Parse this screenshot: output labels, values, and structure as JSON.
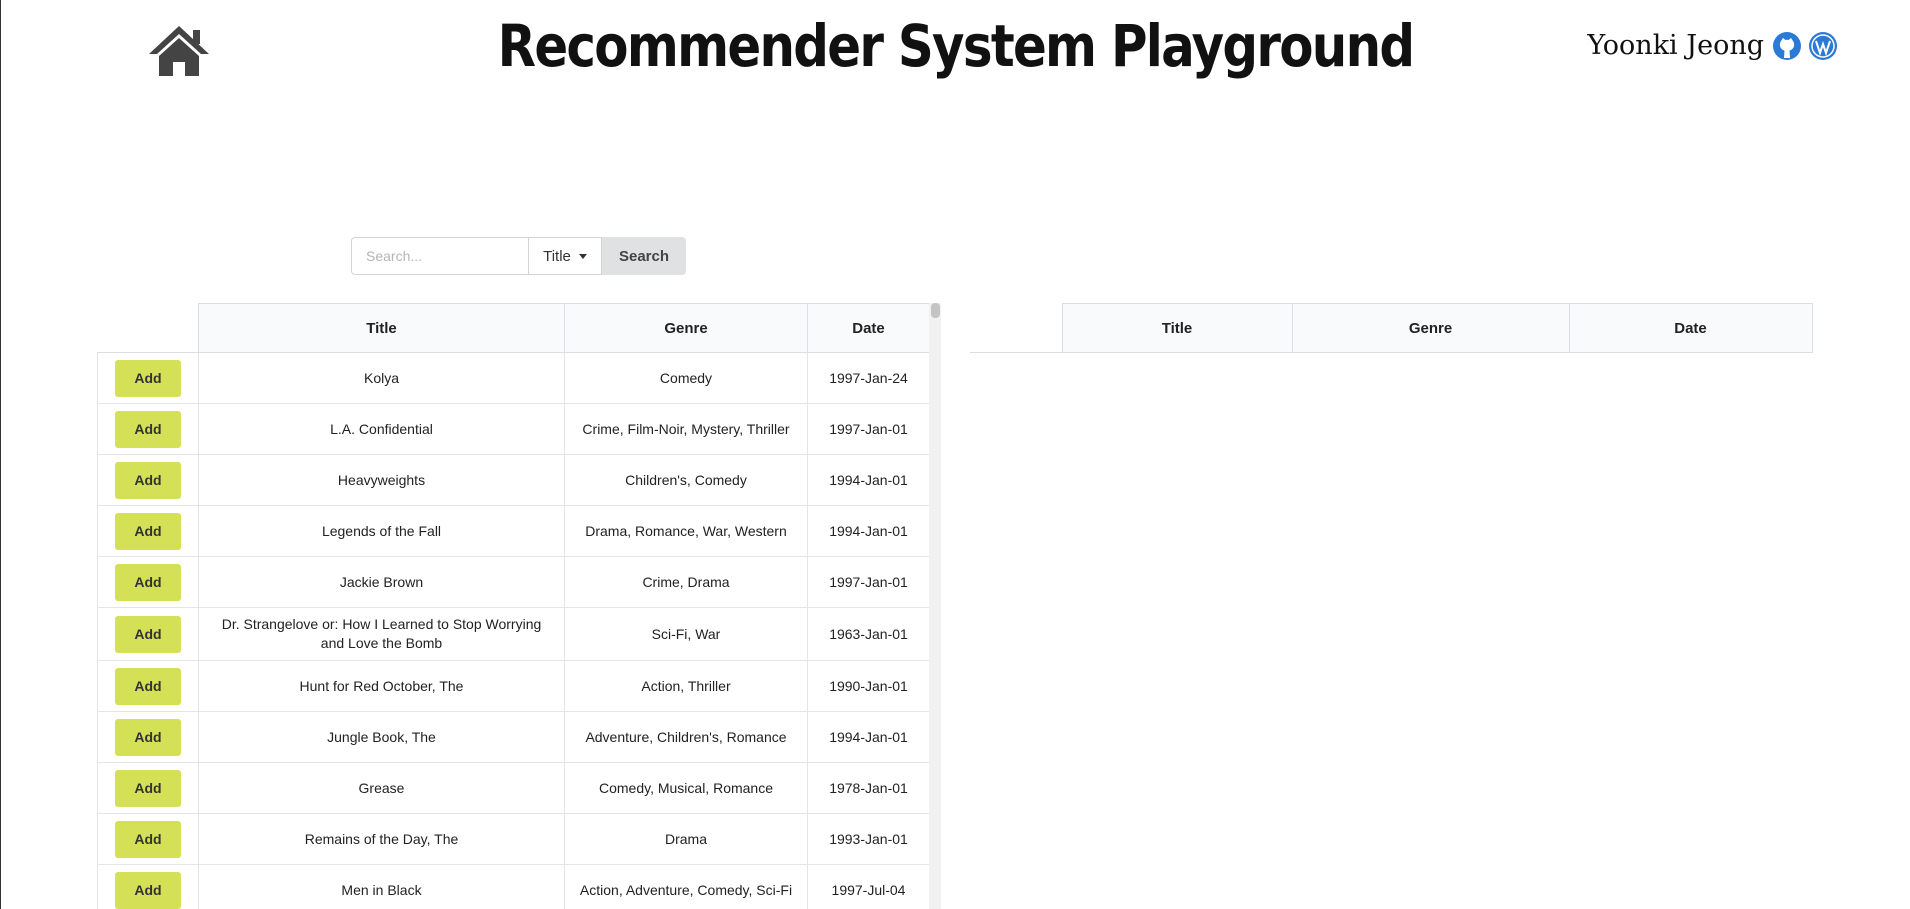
{
  "header": {
    "title": "Recommender System Playground",
    "author": "Yoonki Jeong",
    "icons": [
      "home-icon",
      "github-icon",
      "wordpress-icon"
    ]
  },
  "search": {
    "placeholder": "Search...",
    "field_selected": "Title",
    "button_label": "Search"
  },
  "movies": {
    "columns": [
      "Title",
      "Genre",
      "Date"
    ],
    "add_label": "Add",
    "rows": [
      {
        "title": "Kolya",
        "genre": "Comedy",
        "date": "1997-Jan-24"
      },
      {
        "title": "L.A. Confidential",
        "genre": "Crime, Film-Noir, Mystery, Thriller",
        "date": "1997-Jan-01"
      },
      {
        "title": "Heavyweights",
        "genre": "Children's, Comedy",
        "date": "1994-Jan-01"
      },
      {
        "title": "Legends of the Fall",
        "genre": "Drama, Romance, War, Western",
        "date": "1994-Jan-01"
      },
      {
        "title": "Jackie Brown",
        "genre": "Crime, Drama",
        "date": "1997-Jan-01"
      },
      {
        "title": "Dr. Strangelove or: How I Learned to Stop Worrying and Love the Bomb",
        "genre": "Sci-Fi, War",
        "date": "1963-Jan-01"
      },
      {
        "title": "Hunt for Red October, The",
        "genre": "Action, Thriller",
        "date": "1990-Jan-01"
      },
      {
        "title": "Jungle Book, The",
        "genre": "Adventure, Children's, Romance",
        "date": "1994-Jan-01"
      },
      {
        "title": "Grease",
        "genre": "Comedy, Musical, Romance",
        "date": "1978-Jan-01"
      },
      {
        "title": "Remains of the Day, The",
        "genre": "Drama",
        "date": "1993-Jan-01"
      },
      {
        "title": "Men in Black",
        "genre": "Action, Adventure, Comedy, Sci-Fi",
        "date": "1997-Jul-04"
      }
    ]
  },
  "selected": {
    "columns": [
      "Title",
      "Genre",
      "Date"
    ]
  },
  "colors": {
    "add_button": "#d4e157",
    "search_button": "#e0e1e2",
    "header_bg": "#f9fafb"
  }
}
